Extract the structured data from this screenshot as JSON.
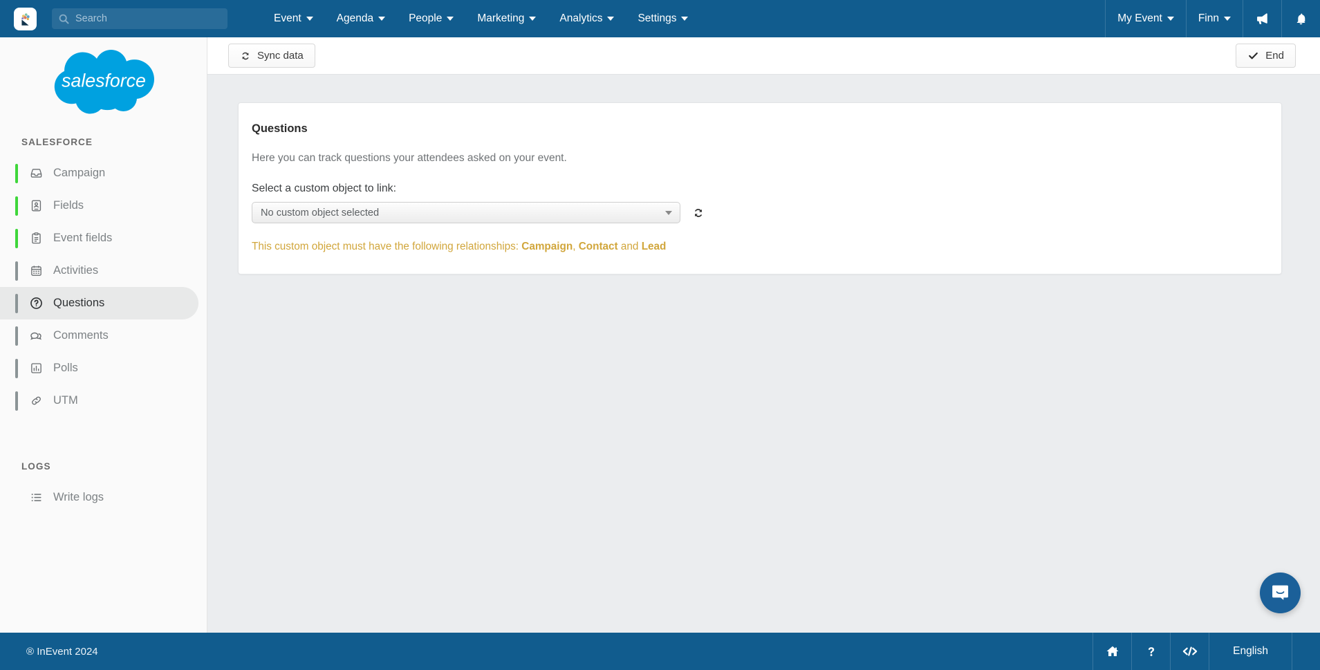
{
  "topnav": {
    "logo_icon": "inevent-logo-icon",
    "search": {
      "placeholder": "Search",
      "value": ""
    },
    "menus": [
      {
        "label": "Event"
      },
      {
        "label": "Agenda"
      },
      {
        "label": "People"
      },
      {
        "label": "Marketing"
      },
      {
        "label": "Analytics"
      },
      {
        "label": "Settings"
      }
    ],
    "right": [
      {
        "label": "My Event"
      },
      {
        "label": "Finn"
      }
    ],
    "announce_icon": "megaphone-icon",
    "bell_icon": "bell-icon"
  },
  "sidebar": {
    "logo_alt": "salesforce",
    "logo_wordmark": "salesforce",
    "section_title": "SALESFORCE",
    "items": [
      {
        "label": "Campaign",
        "icon": "inbox-icon",
        "bar": "green",
        "active": false
      },
      {
        "label": "Fields",
        "icon": "badge-icon",
        "bar": "green",
        "active": false
      },
      {
        "label": "Event fields",
        "icon": "clipboard-icon",
        "bar": "green",
        "active": false
      },
      {
        "label": "Activities",
        "icon": "calendar-icon",
        "bar": "gray",
        "active": false
      },
      {
        "label": "Questions",
        "icon": "question-circle-icon",
        "bar": "gray",
        "active": true
      },
      {
        "label": "Comments",
        "icon": "comments-icon",
        "bar": "gray",
        "active": false
      },
      {
        "label": "Polls",
        "icon": "bar-chart-icon",
        "bar": "gray",
        "active": false
      },
      {
        "label": "UTM",
        "icon": "link-icon",
        "bar": "gray",
        "active": false
      }
    ],
    "logs_section_title": "LOGS",
    "logs_items": [
      {
        "label": "Write logs",
        "icon": "list-icon",
        "bar": "none",
        "active": false
      }
    ]
  },
  "toolbar": {
    "sync_label": "Sync data",
    "sync_icon": "refresh-icon",
    "end_label": "End",
    "end_icon": "check-icon"
  },
  "card": {
    "title": "Questions",
    "description": "Here you can track questions your attendees asked on your event.",
    "field_label": "Select a custom object to link:",
    "select": {
      "value": "No custom object selected",
      "options": [
        "No custom object selected"
      ]
    },
    "refresh_icon": "refresh-objects-icon",
    "warning": {
      "prefix": "This custom object must have the following relationships: ",
      "rel1": "Campaign",
      "sep1": ", ",
      "rel2": "Contact",
      "sep2": " and ",
      "rel3": "Lead",
      "color": "#d1a63b"
    }
  },
  "chat": {
    "icon": "chat-bubble-icon"
  },
  "footer": {
    "copyright": "® InEvent 2024",
    "home_icon": "home-icon",
    "help_icon": "question-mark-icon",
    "code_icon": "code-icon",
    "language": "English"
  },
  "colors": {
    "navbar": "#115c8e",
    "accent_green": "#3ed63a",
    "warning": "#d1a63b",
    "salesforce_blue": "#00a1e0",
    "content_bg": "#ebedef"
  }
}
